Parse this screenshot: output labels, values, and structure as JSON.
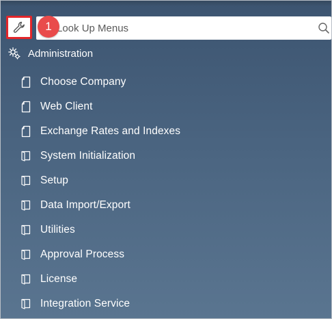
{
  "toolbar": {
    "tool_icon": "wrench-icon",
    "step_badge": "1"
  },
  "search": {
    "placeholder": "Look Up Menus",
    "icon": "search-icon"
  },
  "section": {
    "icon": "administration-gear-icon",
    "label": "Administration"
  },
  "menu_items": [
    {
      "label": "Choose Company",
      "icon": "page-icon"
    },
    {
      "label": "Web Client",
      "icon": "page-icon"
    },
    {
      "label": "Exchange Rates and Indexes",
      "icon": "page-icon"
    },
    {
      "label": "System Initialization",
      "icon": "folder-icon"
    },
    {
      "label": "Setup",
      "icon": "folder-icon"
    },
    {
      "label": "Data Import/Export",
      "icon": "folder-icon"
    },
    {
      "label": "Utilities",
      "icon": "folder-icon"
    },
    {
      "label": "Approval Process",
      "icon": "folder-icon"
    },
    {
      "label": "License",
      "icon": "folder-icon"
    },
    {
      "label": "Integration Service",
      "icon": "folder-icon"
    }
  ],
  "colors": {
    "highlight_border": "#e3262a",
    "badge": "#e94b4b",
    "panel_top": "#3c5470",
    "panel_bottom": "#5a7590"
  }
}
